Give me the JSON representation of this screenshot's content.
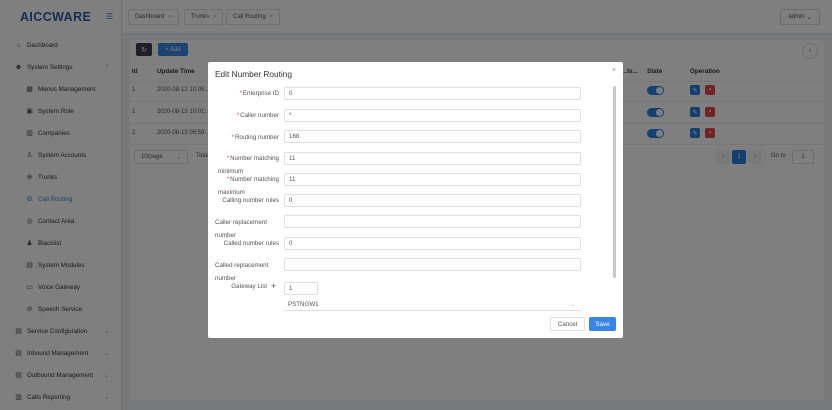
{
  "app": {
    "logo": "AICCWARE",
    "user": "admin"
  },
  "tabs": [
    "Dashboard",
    "Trunks",
    "Call Routing"
  ],
  "sidebar": {
    "dashboard": "Dashboard",
    "system_settings": "System Settings",
    "menus_management": "Menus Management",
    "system_role": "System Role",
    "companies": "Companies",
    "system_accounts": "System Accounts",
    "trunks": "Trunks",
    "call_routing": "Call Routing",
    "contact_area": "Contact Area",
    "blacklist": "Blacklist",
    "system_modules": "System Modules",
    "voice_gateway": "Voice Gateway",
    "speech_service": "Speech Service",
    "service_configuration": "Service Configuration",
    "inbound_management": "Inbound Management",
    "outbound_management": "Outbound Management",
    "calls_reporting": "Calls Reporting"
  },
  "toolbar": {
    "add_label": "+ Add"
  },
  "table": {
    "headers": {
      "id": "Id",
      "update_time": "Update Time",
      "cut": "...ls...",
      "state": "State",
      "operation": "Operation"
    },
    "rows": [
      {
        "id": "1",
        "update_time": "2020-08-12 10:05:..."
      },
      {
        "id": "1",
        "update_time": "2020-08-13 10:01:..."
      },
      {
        "id": "2",
        "update_time": "2020-08-13 09:59:..."
      }
    ]
  },
  "pager": {
    "size": "10/page",
    "total": "Total",
    "current": "1",
    "goto_label": "Go to",
    "goto_value": "1"
  },
  "modal": {
    "title": "Edit Number Routing",
    "enterprise_id": {
      "label": "Enterprise ID",
      "value": "0"
    },
    "caller_number": {
      "label": "Caller number",
      "value": "*"
    },
    "routing_number": {
      "label": "Routing number",
      "value": "168"
    },
    "number_matching": {
      "label": "Number matching",
      "value": "11"
    },
    "min_number_matching": {
      "label_top": "minimum",
      "label": "Number matching",
      "value": "11"
    },
    "calling_number_rules": {
      "label_top": "maximum",
      "label": "Calling number rules",
      "value": "0"
    },
    "caller_replacement": {
      "label": "Caller replacement",
      "label_bottom": "number",
      "value": ""
    },
    "called_number_rules": {
      "label": "Called number rules",
      "value": "0"
    },
    "called_replacement": {
      "label": "Called replacement",
      "label_bottom": "number",
      "value": ""
    },
    "gateway_list": {
      "label": "Gateway List",
      "value": "1",
      "selected": "PSTNGW1"
    },
    "cancel_label": "Cancel",
    "save_label": "Save"
  }
}
